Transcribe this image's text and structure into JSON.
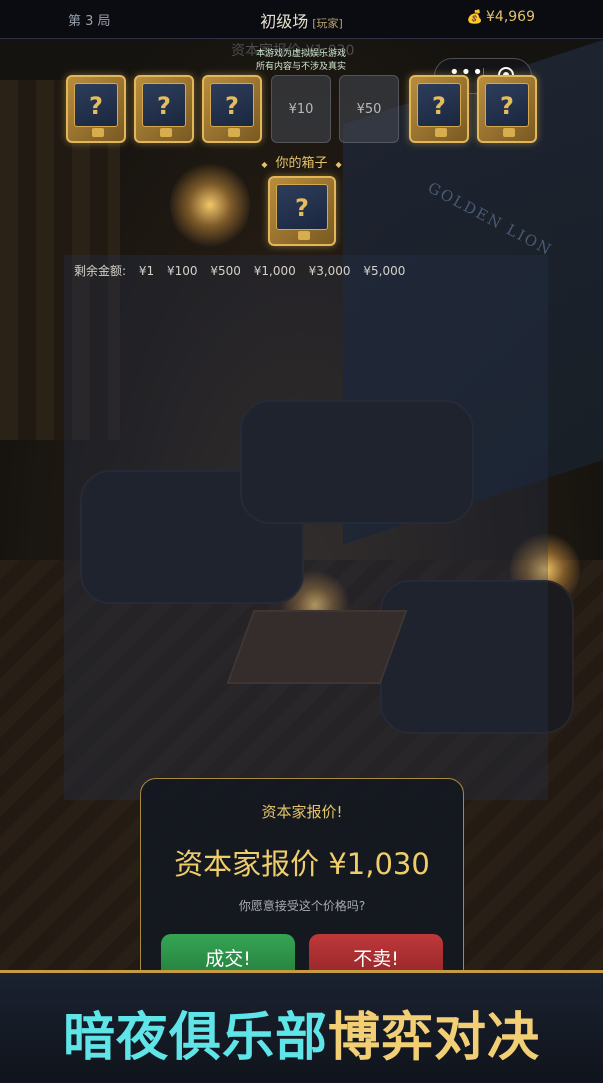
{
  "topbar": {
    "round": "第 3 局",
    "title": "初级场",
    "tag": "[玩家]",
    "bag_icon": "money-bag-icon",
    "balance": "¥4,969"
  },
  "notice": {
    "ghost": "资本家报价 ¥1,030",
    "line1": "本游戏为虚拟娱乐游戏",
    "line2": "所有内容与不涉及真实"
  },
  "boxes_row": [
    {
      "type": "mystery"
    },
    {
      "type": "mystery"
    },
    {
      "type": "mystery"
    },
    {
      "type": "opened",
      "value": "¥10"
    },
    {
      "type": "opened",
      "value": "¥50"
    },
    {
      "type": "mystery"
    },
    {
      "type": "mystery"
    }
  ],
  "your_box": {
    "label": "你的箱子"
  },
  "remaining": {
    "label": "剩余金额:",
    "amounts": [
      "¥1",
      "¥100",
      "¥500",
      "¥1,000",
      "¥3,000",
      "¥5,000"
    ]
  },
  "dialog": {
    "title": "资本家报价!",
    "offer": "资本家报价 ¥1,030",
    "question": "你愿意接受这个价格吗?",
    "deal_label": "成交!",
    "nodeal_label": "不卖!"
  },
  "scene": {
    "sign": "GOLDEN LION"
  },
  "banner": {
    "part1": "暗夜俱乐部",
    "part2": "博弈对决"
  },
  "colors": {
    "gold": "#e3c46b",
    "deal_green": "#35a553",
    "nodeal_red": "#c0383a",
    "banner_cyan": "#5fe4e8"
  }
}
